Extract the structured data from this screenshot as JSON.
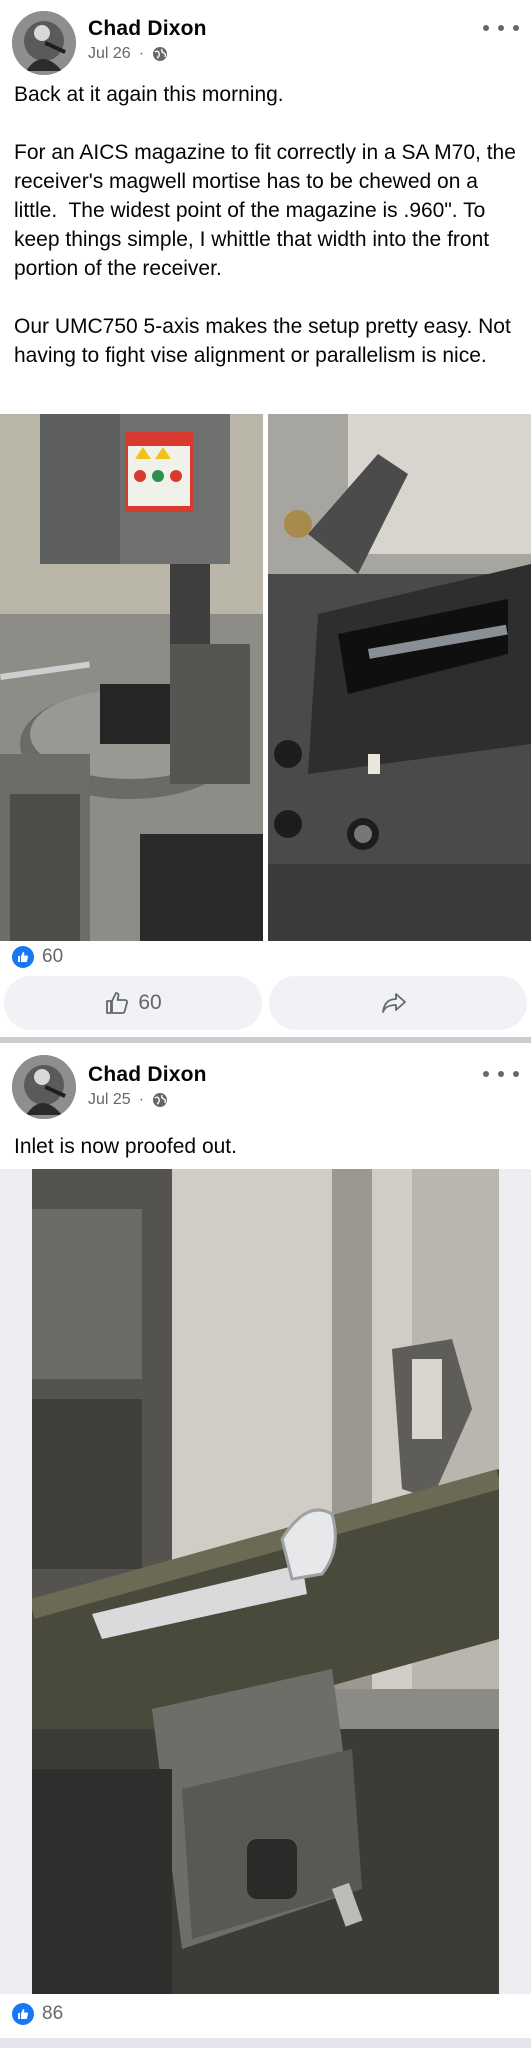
{
  "posts": [
    {
      "author": "Chad Dixon",
      "date": "Jul 26",
      "separator": "·",
      "privacy_icon": "globe-icon",
      "more_icon": "more-dots-icon",
      "text": "Back at it again this morning.\n\nFor an AICS magazine to fit correctly in a SA M70, the receiver's magwell mortise has to be chewed on a little.  The widest point of the magazine is .960\". To keep things simple, I whittle that width into the front portion of the receiver.\n\nOur UMC750 5-axis makes the setup pretty easy. Not having to fight vise alignment or parallelism is nice.",
      "reaction_count": "60",
      "like_button_count": "60",
      "like_icon": "thumbs-up-icon",
      "share_icon": "share-arrow-icon"
    },
    {
      "author": "Chad Dixon",
      "date": "Jul 25",
      "separator": "·",
      "privacy_icon": "globe-icon",
      "more_icon": "more-dots-icon",
      "text": "Inlet is now proofed out.",
      "reaction_count": "86"
    }
  ],
  "colors": {
    "like_blue": "#1877f2",
    "secondary_text": "#65676b",
    "button_bg": "#f0f2f5",
    "divider": "#c9ccd1"
  }
}
